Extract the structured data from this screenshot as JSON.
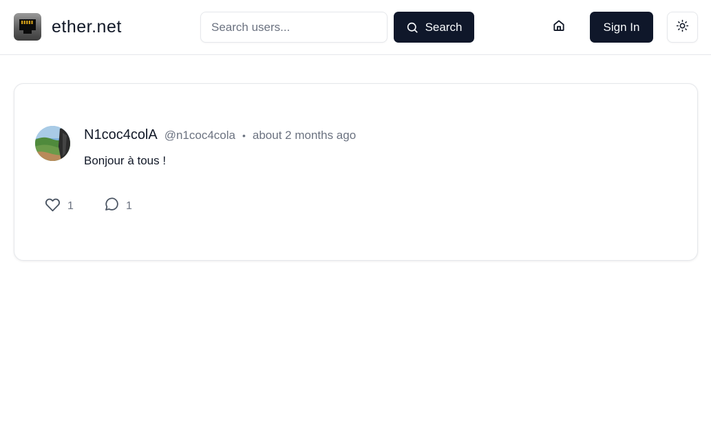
{
  "header": {
    "brand": "ether.net",
    "search": {
      "placeholder": "Search users...",
      "value": "",
      "button_label": "Search"
    },
    "signin_label": "Sign In",
    "icons": {
      "logo": "ethernet-port-icon",
      "search": "search-icon",
      "home": "home-icon",
      "theme": "sun-icon"
    }
  },
  "post": {
    "display_name": "N1coc4colA",
    "handle": "@n1coc4cola",
    "separator": "•",
    "timestamp": "about 2 months ago",
    "content": "Bonjour à tous !",
    "likes": "1",
    "comments": "1"
  },
  "colors": {
    "primary": "#0f172a",
    "muted_text": "#6b7280",
    "border": "#e5e7eb"
  }
}
